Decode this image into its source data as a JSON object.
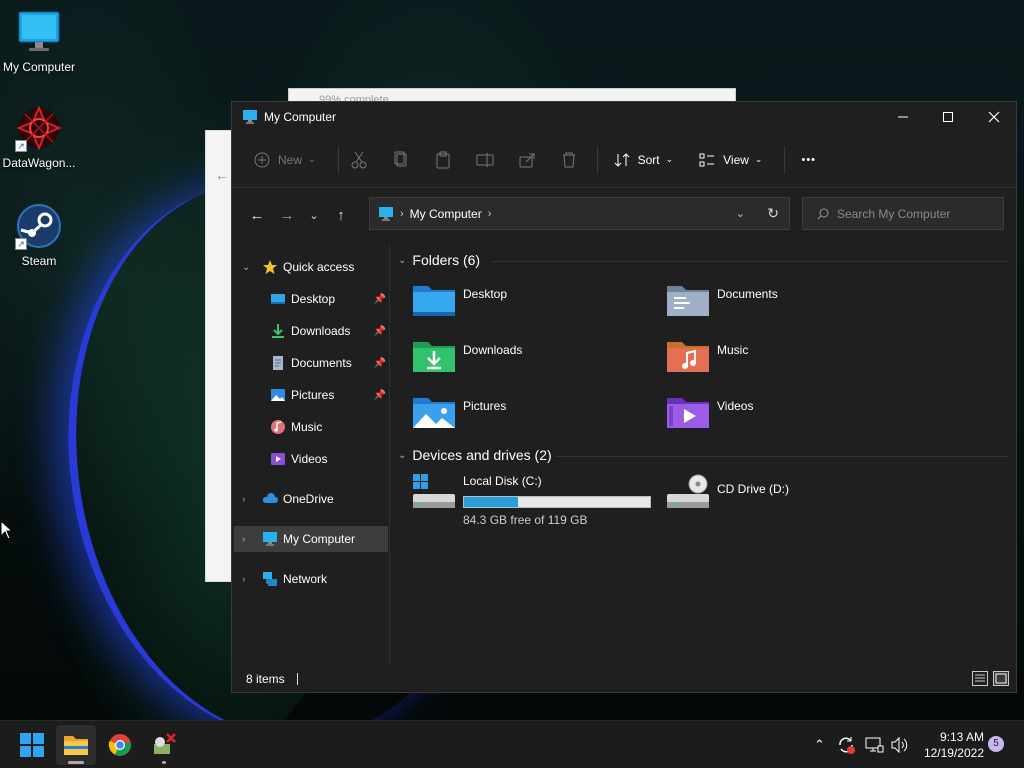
{
  "desktop": {
    "icons": [
      {
        "label": "My Computer"
      },
      {
        "label": "DataWagon..."
      },
      {
        "label": "Steam"
      }
    ]
  },
  "background_dialog": {
    "text": "99% complete"
  },
  "window": {
    "title": "My Computer",
    "toolbar": {
      "new_label": "New",
      "sort_label": "Sort",
      "view_label": "View",
      "more_label": "•••"
    },
    "address": {
      "crumb": "My Computer"
    },
    "search": {
      "placeholder": "Search My Computer"
    },
    "sidebar": {
      "quick_access": "Quick access",
      "items": [
        {
          "label": "Desktop",
          "pinned": true
        },
        {
          "label": "Downloads",
          "pinned": true
        },
        {
          "label": "Documents",
          "pinned": true
        },
        {
          "label": "Pictures",
          "pinned": true
        },
        {
          "label": "Music",
          "pinned": false
        },
        {
          "label": "Videos",
          "pinned": false
        }
      ],
      "onedrive": "OneDrive",
      "my_computer": "My Computer",
      "network": "Network"
    },
    "folders_group": "Folders (6)",
    "folders": [
      {
        "name": "Desktop"
      },
      {
        "name": "Documents"
      },
      {
        "name": "Downloads"
      },
      {
        "name": "Music"
      },
      {
        "name": "Pictures"
      },
      {
        "name": "Videos"
      }
    ],
    "drives_group": "Devices and drives (2)",
    "drives": [
      {
        "name": "Local Disk (C:)",
        "free": "84.3 GB free of 119 GB",
        "used_fraction": 0.29
      },
      {
        "name": "CD Drive (D:)"
      }
    ],
    "status": {
      "items": "8 items"
    }
  },
  "taskbar": {
    "clock_time": "9:13 AM",
    "clock_date": "12/19/2022",
    "notification_count": "5"
  },
  "colors": {
    "accent": "#26a0da",
    "folder_blue": "#2f8ae0",
    "selection": "#3d3d3d"
  }
}
